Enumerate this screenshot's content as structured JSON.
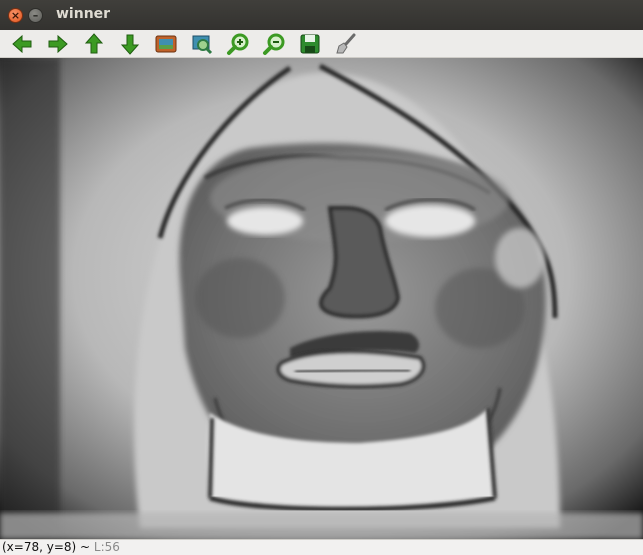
{
  "window": {
    "title": "winner",
    "close_glyph": "×",
    "minimize_glyph": "–"
  },
  "toolbar": {
    "buttons": [
      {
        "icon": "arrow-left-icon",
        "color": "#3c9a23"
      },
      {
        "icon": "arrow-right-icon",
        "color": "#3c9a23"
      },
      {
        "icon": "arrow-up-icon",
        "color": "#3c9a23"
      },
      {
        "icon": "arrow-down-icon",
        "color": "#3c9a23"
      },
      {
        "icon": "zoom-fit-icon",
        "color": "#c0622a"
      },
      {
        "icon": "zoom-original-icon",
        "color": "#2f7a44"
      },
      {
        "icon": "zoom-in-icon",
        "color": "#3c9a23"
      },
      {
        "icon": "zoom-out-icon",
        "color": "#3c9a23"
      },
      {
        "icon": "save-icon",
        "color": "#2e8b2e"
      },
      {
        "icon": "properties-icon",
        "color": "#8a8a8a"
      }
    ]
  },
  "statusbar": {
    "coords": "(x=78, y=8) ~",
    "value": "L:56"
  }
}
